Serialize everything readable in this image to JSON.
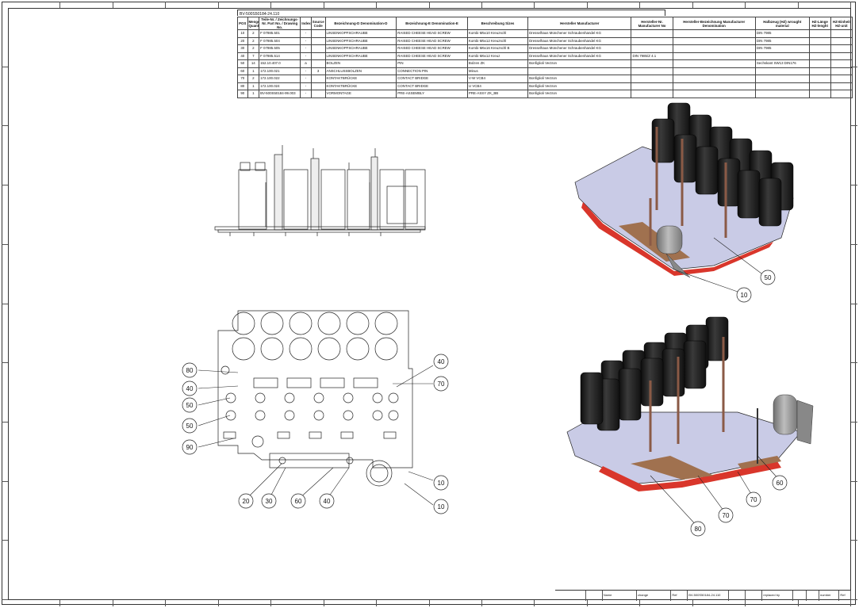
{
  "bom": {
    "drawing_id": "BV-500S50184-24.110",
    "headers": [
      "POS",
      "Menge Quantity",
      "Teile-Nr. / Zeichnungs-Nr. Part No. / Drawing No.",
      "Index",
      "Source Code",
      "Bezeichnung-D Denomination-D",
      "Bezeichnung-E Denomination-E",
      "Beschreibung Sizes",
      "Hersteller Manufacturer",
      "Hersteller-Nr. Manufacturer No",
      "Hersteller-Bezeichnung Manufacturer Denomination",
      "Halbzeug (HZ) wrought material",
      "HZ-Länge HZ-lenght",
      "HZ-Einheit HZ-unit"
    ],
    "rows": [
      [
        "10",
        "2",
        "F 07985.501",
        "-",
        "",
        "LINSENKOPFSCHRAUBE",
        "RAISED CHEESE HEAD SCREW",
        "Kombi M5x10 Kreuzschl",
        "Dresselhaus Münchener Schraubenhandel KG",
        "",
        "",
        "DIN 7985",
        "",
        ""
      ],
      [
        "20",
        "2",
        "F 07985.504",
        "-",
        "",
        "LINSENKOPFSCHRAUBE",
        "RAISED CHEESE HEAD SCREW",
        "Kombi M5x12 Kreuzschl",
        "Dresselhaus Münchener Schraubenhandel KG",
        "",
        "",
        "DIN 7985",
        "",
        ""
      ],
      [
        "30",
        "2",
        "F 07985.505",
        "-",
        "",
        "LINSENKOPFSCHRAUBE",
        "RAISED CHEESE HEAD SCREW",
        "Kombi M6x16 Kreuzschl B",
        "Dresselhaus Münchener Schraubenhandel KG",
        "",
        "",
        "DIN 7985",
        "",
        ""
      ],
      [
        "40",
        "7",
        "F 07985.514",
        "-",
        "",
        "LINSENKOPFSCHRAUBE",
        "RAISED CHEESE HEAD SCREW",
        "Kombi M6x12 Kreuz",
        "Dresselhaus Münchener Schraubenhandel KG",
        "DIN 7985/Z 4.1",
        "",
        "",
        "",
        ""
      ],
      [
        "50",
        "14",
        "152.10.407.0",
        "a",
        "",
        "BOLZEN",
        "PIN",
        "Bolzen ZK",
        "Bonfiglioli Vectron",
        "",
        "",
        "Sechskant SW13 DIN176",
        "",
        ""
      ],
      [
        "60",
        "1",
        "172.100.021",
        "-",
        "3",
        "ANSCHLUSSBOLZEN",
        "CONNECTION PIN",
        "Minus",
        "",
        "",
        "",
        "",
        "",
        ""
      ],
      [
        "70",
        "2",
        "172.100.022",
        "-",
        "",
        "KONTAKTBRÜCKE",
        "CONTACT BRIDGE",
        "V-W VCB4",
        "Bonfiglioli Vectron",
        "",
        "",
        "",
        "",
        ""
      ],
      [
        "80",
        "1",
        "172.100.024",
        "-",
        "",
        "KONTAKTBRÜCKE",
        "CONTACT BRIDGE",
        "U VCB4",
        "Bonfiglioli Vectron",
        "",
        "",
        "",
        "",
        ""
      ],
      [
        "90",
        "1",
        "BV-500S50184-99.003",
        "-",
        "",
        "VORMONTAGE",
        "PRE-ASSEMBLY",
        "PRE-ASSY ZK_BB",
        "Bonfiglioli Vectron",
        "",
        "",
        "",
        "",
        ""
      ]
    ]
  },
  "callouts": {
    "iso1": [
      "50",
      "10"
    ],
    "top": [
      "80",
      "40",
      "50",
      "50",
      "90",
      "40",
      "70",
      "10",
      "10",
      "20",
      "30",
      "60",
      "40"
    ],
    "iso2": [
      "60",
      "70",
      "70",
      "80"
    ]
  },
  "titleblock": {
    "cells": [
      "",
      "",
      "Name",
      "change",
      "Ref",
      "BV-500S50184-24.110",
      "",
      "",
      "replaced by",
      "",
      "",
      "number",
      "Ref"
    ]
  },
  "colors": {
    "line": "#222222",
    "capacitor": "#1b1b1b",
    "plate": "#c9cbe6",
    "bus_red": "#d9362b",
    "copper": "#a0714f",
    "motor": "#9a9a9a"
  }
}
